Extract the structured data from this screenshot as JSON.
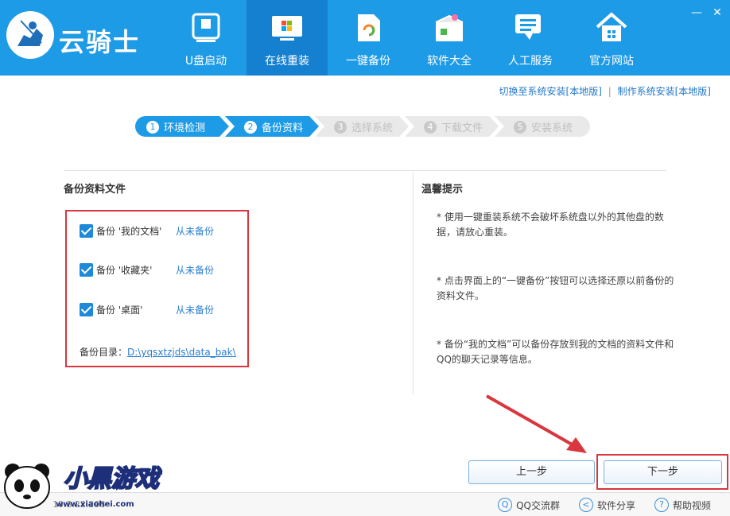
{
  "app": {
    "title": "云骑士"
  },
  "nav": [
    {
      "label": "U盘启动",
      "icon": "usb-drive-icon"
    },
    {
      "label": "在线重装",
      "icon": "windows-monitor-icon",
      "active": true
    },
    {
      "label": "一键备份",
      "icon": "backup-file-icon"
    },
    {
      "label": "软件大全",
      "icon": "software-box-icon"
    },
    {
      "label": "人工服务",
      "icon": "chat-support-icon"
    },
    {
      "label": "官方网站",
      "icon": "home-icon"
    }
  ],
  "window_controls": {
    "minimize": "—",
    "close": "✕"
  },
  "top_links": {
    "switch_install": "切换至系统安装[本地版]",
    "separator": "|",
    "make_install": "制作系统安装[本地版]"
  },
  "steps": [
    {
      "num": "1",
      "label": "环境检测",
      "state": "on"
    },
    {
      "num": "2",
      "label": "备份资料",
      "state": "on"
    },
    {
      "num": "3",
      "label": "选择系统",
      "state": "off"
    },
    {
      "num": "4",
      "label": "下载文件",
      "state": "off"
    },
    {
      "num": "5",
      "label": "安装系统",
      "state": "off"
    }
  ],
  "backup": {
    "title": "备份资料文件",
    "items": [
      {
        "label": "备份 '我的文档'",
        "status": "从未备份",
        "checked": true
      },
      {
        "label": "备份 '收藏夹'",
        "status": "从未备份",
        "checked": true
      },
      {
        "label": "备份 '桌面'",
        "status": "从未备份",
        "checked": true
      }
    ],
    "dir_label": "备份目录：",
    "dir_path": "D:\\yqsxtzjds\\data_bak\\"
  },
  "tips": {
    "title": "温馨提示",
    "items": [
      "* 使用一键重装系统不会破坏系统盘以外的其他盘的数据，请放心重装。",
      "* 点击界面上的“一键备份”按钮可以选择还原以前备份的资料文件。",
      "* 备份“我的文档”可以备份存放到我的文档的资料文件和QQ的聊天记录等信息。"
    ]
  },
  "buttons": {
    "prev": "上一步",
    "next": "下一步"
  },
  "footer": {
    "version": "10.3.22.298",
    "links": [
      {
        "label": "QQ交流群",
        "icon": "qq-icon"
      },
      {
        "label": "软件分享",
        "icon": "share-icon"
      },
      {
        "label": "帮助视频",
        "icon": "help-icon"
      }
    ]
  },
  "watermark": {
    "text": "小黑游戏",
    "url": "www.xiaohei.com"
  },
  "colors": {
    "header": "#1e9be6",
    "nav_active": "#157fd0",
    "highlight_red": "#d9363e",
    "link_blue": "#2b7fd4"
  }
}
